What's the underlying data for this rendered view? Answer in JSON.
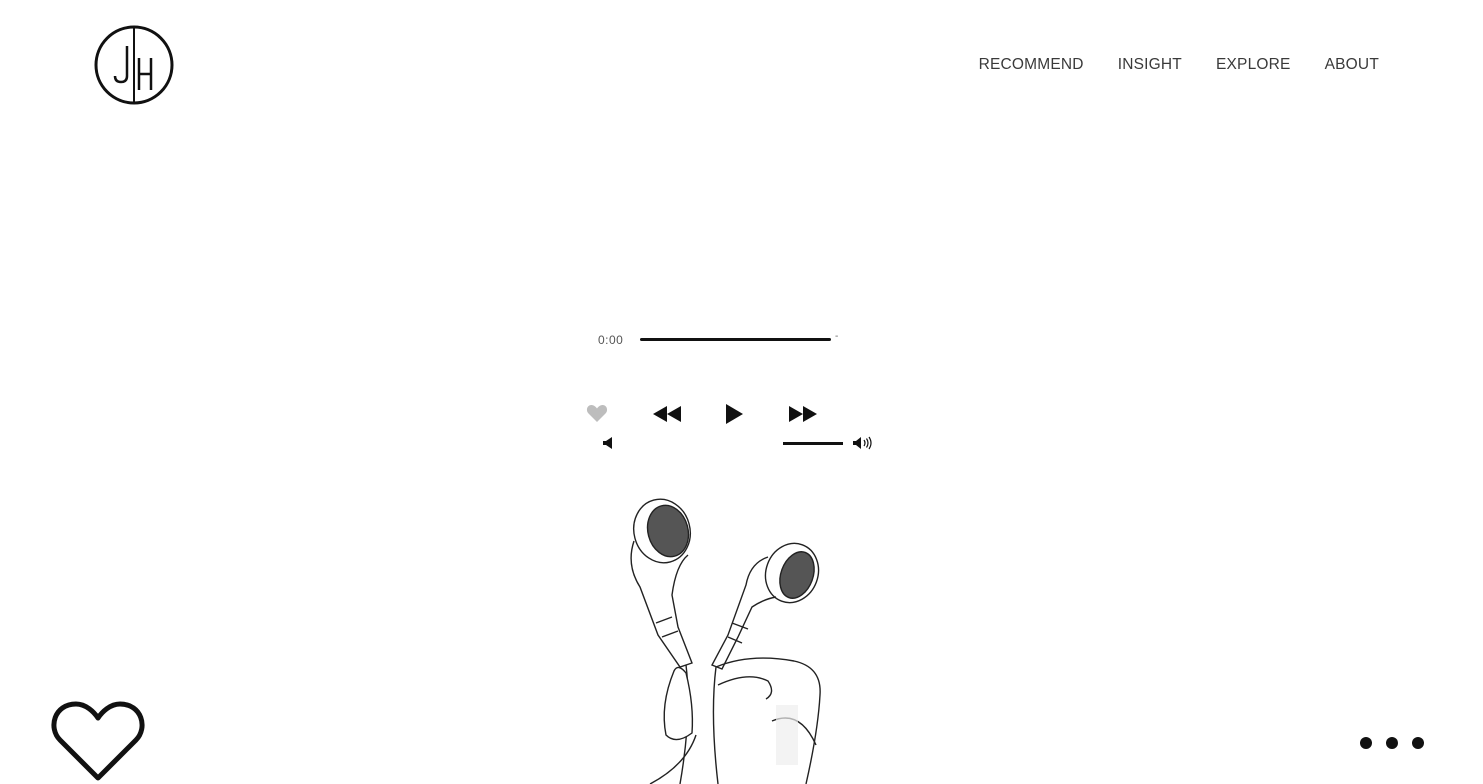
{
  "brand": {
    "logo_text": "JH"
  },
  "nav": {
    "items": [
      {
        "label": "RECOMMEND"
      },
      {
        "label": "INSIGHT"
      },
      {
        "label": "EXPLORE"
      },
      {
        "label": "ABOUT"
      }
    ]
  },
  "player": {
    "current_time": "0:00",
    "duration": "-",
    "progress": 0,
    "volume": 1,
    "icons": {
      "like": "heart-icon",
      "rewind": "rewind-icon",
      "play": "play-icon",
      "forward": "fast-forward-icon",
      "mute": "volume-mute-icon",
      "max": "volume-max-icon"
    }
  },
  "colors": {
    "text": "#333333",
    "accent": "#111111",
    "like_inactive": "#bdbdbd"
  }
}
